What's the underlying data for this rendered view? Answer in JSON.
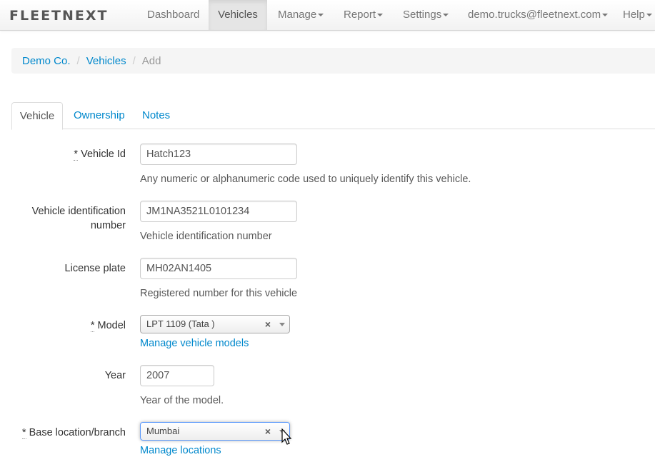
{
  "navbar": {
    "brand": "FLEETNEXT",
    "items": [
      {
        "label": "Dashboard",
        "active": false,
        "dropdown": false
      },
      {
        "label": "Vehicles",
        "active": true,
        "dropdown": false
      },
      {
        "label": "Manage",
        "active": false,
        "dropdown": true
      },
      {
        "label": "Report",
        "active": false,
        "dropdown": true
      },
      {
        "label": "Settings",
        "active": false,
        "dropdown": true
      },
      {
        "label": "demo.trucks@fleetnext.com",
        "active": false,
        "dropdown": true
      },
      {
        "label": "Help",
        "active": false,
        "dropdown": true
      }
    ]
  },
  "breadcrumb": {
    "items": [
      "Demo Co.",
      "Vehicles"
    ],
    "active": "Add",
    "separator": "/"
  },
  "tabs": [
    "Vehicle",
    "Ownership",
    "Notes"
  ],
  "form": {
    "vehicle_id": {
      "label": "Vehicle Id",
      "required": "*",
      "value": "Hatch123",
      "help": "Any numeric or alphanumeric code used to uniquely identify this vehicle."
    },
    "vin": {
      "label_line1": "Vehicle identification",
      "label_line2": "number",
      "value": "JM1NA3521L0101234",
      "help": "Vehicle identification number"
    },
    "license_plate": {
      "label": "License plate",
      "value": "MH02AN1405",
      "help": "Registered number for this vehicle"
    },
    "model": {
      "label": "Model",
      "required": "*",
      "value": "LPT 1109 (Tata )",
      "clear": "×",
      "link": "Manage vehicle models"
    },
    "year": {
      "label": "Year",
      "value": "2007",
      "help": "Year of the model."
    },
    "base_location": {
      "label": "Base location/branch",
      "required": "*",
      "value": "Mumbai",
      "clear": "×",
      "link": "Manage locations"
    }
  },
  "colors": {
    "link": "#0088cc",
    "focus_border": "#5897fb"
  }
}
